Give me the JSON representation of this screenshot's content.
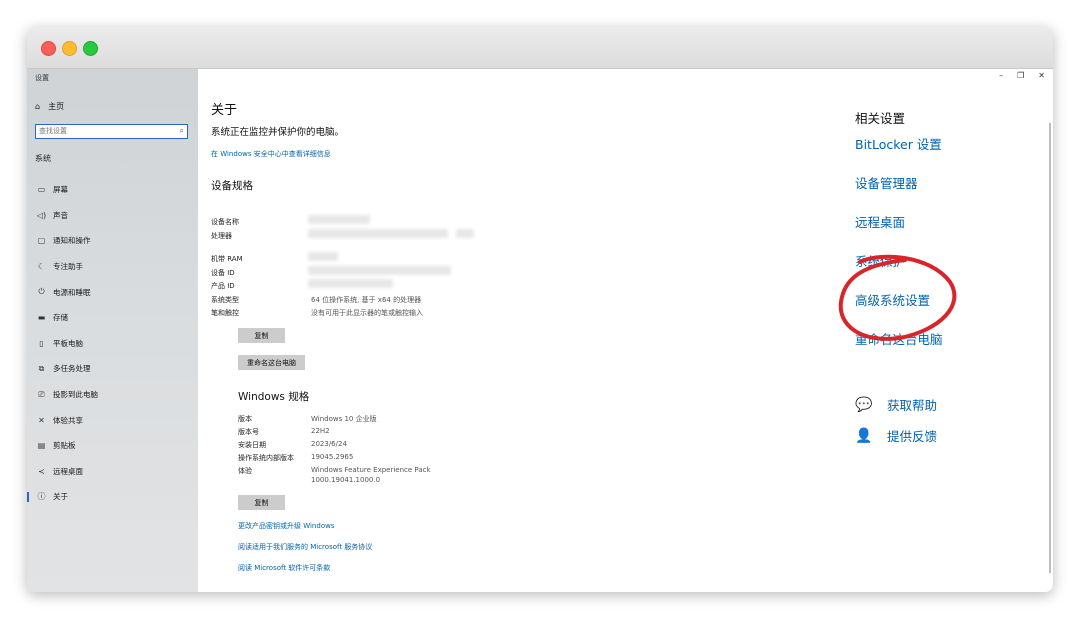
{
  "sidebar": {
    "title": "设置",
    "home": "主页",
    "search_placeholder": "查找设置",
    "section": "系统",
    "items": [
      {
        "label": "屏幕",
        "icon": "monitor-icon"
      },
      {
        "label": "声音",
        "icon": "speaker-icon"
      },
      {
        "label": "通知和操作",
        "icon": "notification-icon"
      },
      {
        "label": "专注助手",
        "icon": "moon-icon"
      },
      {
        "label": "电源和睡眠",
        "icon": "power-icon"
      },
      {
        "label": "存储",
        "icon": "storage-icon"
      },
      {
        "label": "平板电脑",
        "icon": "tablet-icon"
      },
      {
        "label": "多任务处理",
        "icon": "multitask-icon"
      },
      {
        "label": "投影到此电脑",
        "icon": "project-icon"
      },
      {
        "label": "体验共享",
        "icon": "share-icon"
      },
      {
        "label": "剪贴板",
        "icon": "clipboard-icon"
      },
      {
        "label": "远程桌面",
        "icon": "remote-icon"
      },
      {
        "label": "关于",
        "icon": "info-icon",
        "active": true
      }
    ]
  },
  "main": {
    "title": "关于",
    "protect_text": "系统正在监控并保护你的电脑。",
    "security_link": "在 Windows 安全中心中查看详细信息",
    "device_spec": {
      "heading": "设备规格",
      "labels": {
        "device_name": "设备名称",
        "processor": "处理器",
        "ram": "机带 RAM",
        "device_id": "设备 ID",
        "product_id": "产品 ID",
        "system_type": "系统类型",
        "pen_touch": "笔和触控"
      },
      "values": {
        "system_type": "64 位操作系统, 基于 x64 的处理器",
        "pen_touch": "没有可用于此显示器的笔或触控输入"
      },
      "copy_button": "复制",
      "rename_button": "重命名这台电脑"
    },
    "windows_spec": {
      "heading": "Windows 规格",
      "rows": [
        {
          "label": "版本",
          "value": "Windows 10 企业版"
        },
        {
          "label": "版本号",
          "value": "22H2"
        },
        {
          "label": "安装日期",
          "value": "2023/6/24"
        },
        {
          "label": "操作系统内部版本",
          "value": "19045.2965"
        },
        {
          "label": "体验",
          "value": "Windows Feature Experience Pack"
        }
      ],
      "experience_line2": "1000.19041.1000.0",
      "copy_button": "复制"
    },
    "bottom_links": [
      "更改产品密钥或升级 Windows",
      "阅读适用于我们服务的 Microsoft 服务协议",
      "阅读 Microsoft 软件许可条款"
    ]
  },
  "related": {
    "title": "相关设置",
    "links": [
      "BitLocker 设置",
      "设备管理器",
      "远程桌面",
      "系统保护",
      "高级系统设置",
      "重命名这台电脑"
    ],
    "help": [
      {
        "label": "获取帮助",
        "icon": "help-chat-icon"
      },
      {
        "label": "提供反馈",
        "icon": "feedback-icon"
      }
    ]
  },
  "window_controls": {
    "minimize": "–",
    "maximize": "❐",
    "close": "✕"
  },
  "annotation_color": "#d9252a"
}
